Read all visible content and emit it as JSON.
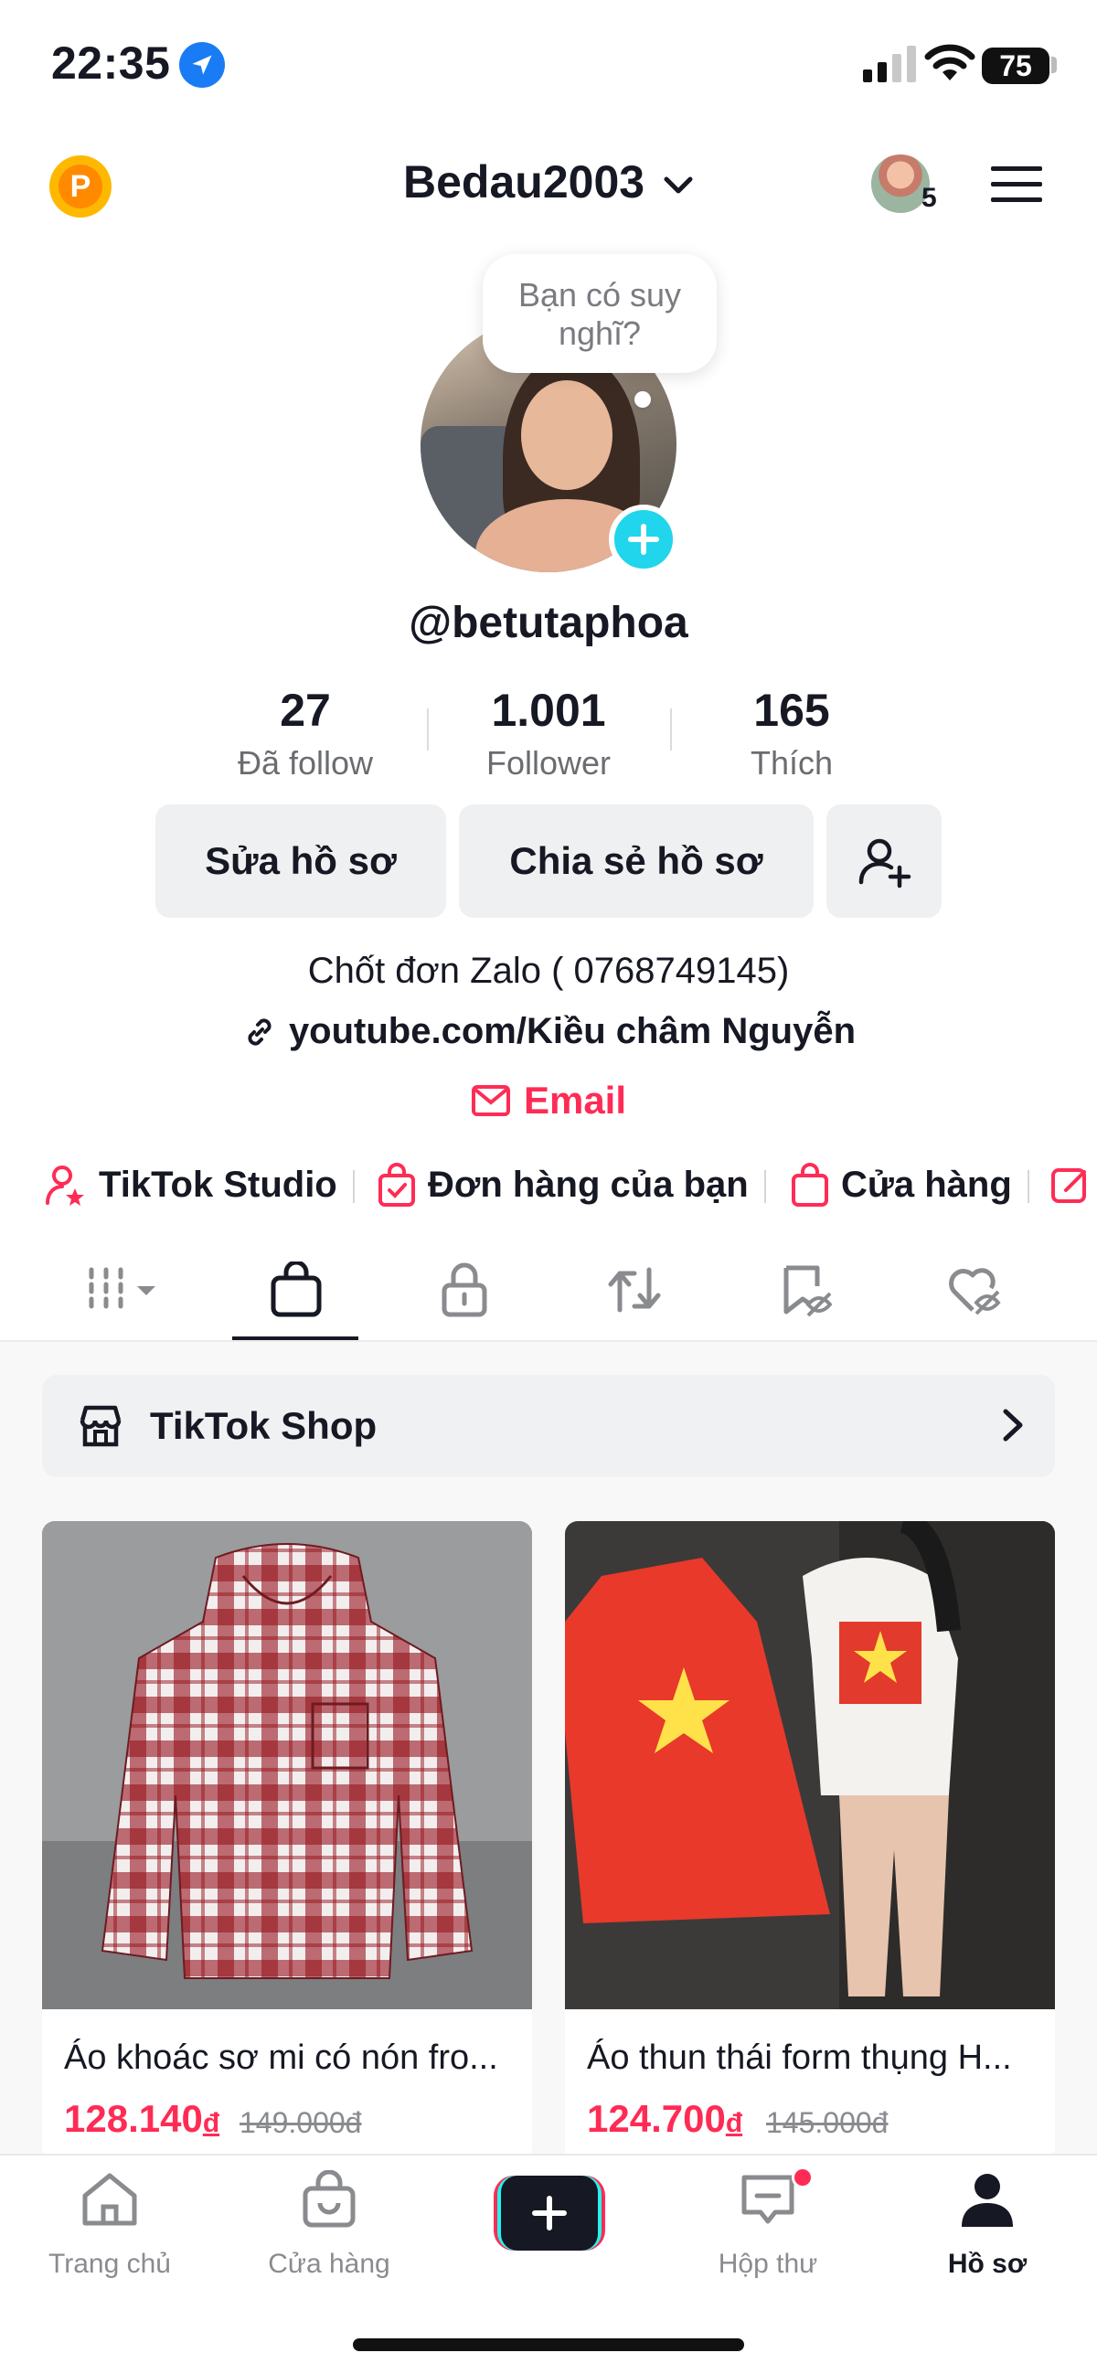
{
  "status_bar": {
    "time": "22:35",
    "battery": "75"
  },
  "header": {
    "username": "Bedau2003",
    "mini_badge_count": "5"
  },
  "profile": {
    "bubble_text": "Bạn có suy nghĩ?",
    "handle": "@betutaphoa",
    "stats": [
      {
        "value": "27",
        "label": "Đã follow"
      },
      {
        "value": "1.001",
        "label": "Follower"
      },
      {
        "value": "165",
        "label": "Thích"
      }
    ],
    "buttons": {
      "edit": "Sửa hồ sơ",
      "share": "Chia sẻ hồ sơ"
    },
    "bio": "Chốt đơn Zalo ( 0768749145)",
    "link": "youtube.com/Kiều châm Nguyễn",
    "email": "Email"
  },
  "quick_links": [
    "TikTok Studio",
    "Đơn hàng của bạn",
    "Cửa hàng"
  ],
  "tabs": [
    "videos-grid",
    "shop",
    "private",
    "reposts",
    "saved",
    "liked"
  ],
  "shop_bar": {
    "label": "TikTok Shop"
  },
  "products": [
    {
      "title": "Áo khoác sơ mi có nón fro...",
      "price": "128.140",
      "currency": "đ",
      "old_price": "149.000đ"
    },
    {
      "title": "Áo thun thái form thụng  H...",
      "price": "124.700",
      "currency": "đ",
      "old_price": "145.000đ"
    }
  ],
  "bottom_nav": [
    "Trang chủ",
    "Cửa hàng",
    "Hộp thư",
    "Hồ sơ"
  ],
  "colors": {
    "accent": "#fe2c55",
    "cyan": "#20d5ec",
    "text": "#161823"
  }
}
